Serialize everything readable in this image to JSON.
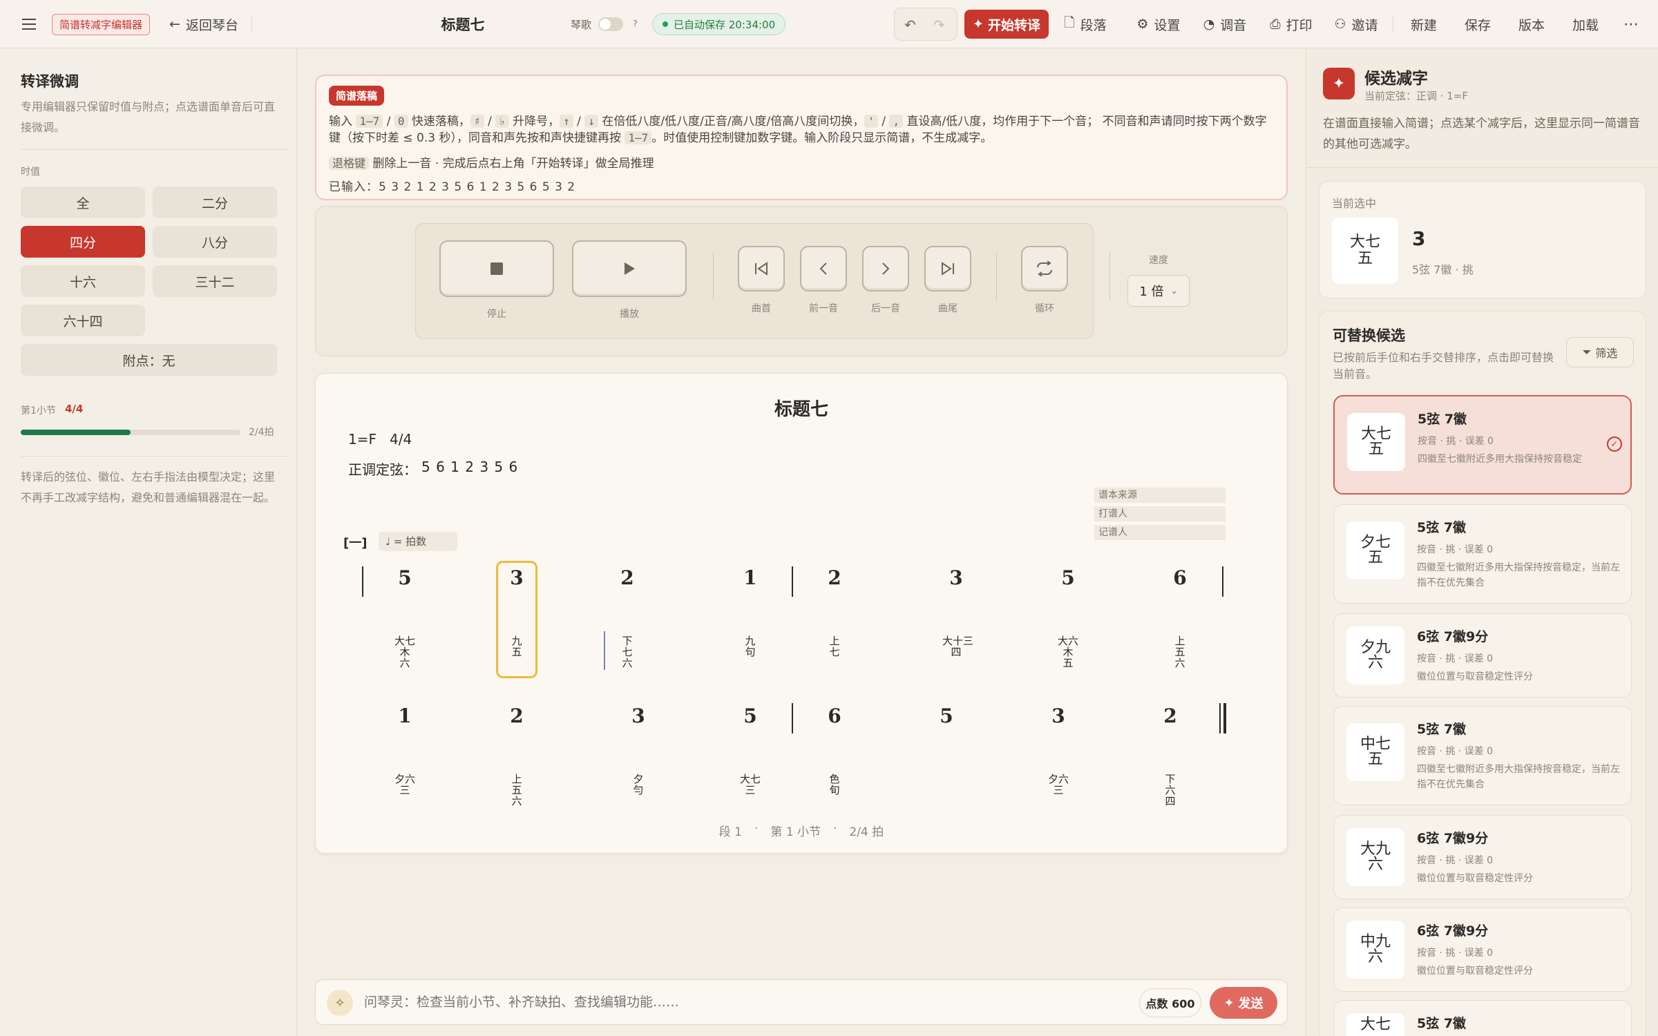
{
  "topbar": {
    "app_badge": "简谱转减字编辑器",
    "back_label": "返回琴台",
    "title": "标题七",
    "sing_label": "琴歌",
    "help": "?",
    "autosave": "已自动保存 20:34:00",
    "start_label": "开始转译",
    "menu": [
      "段落",
      "设置",
      "调音",
      "打印",
      "邀请"
    ],
    "actions": [
      "新建",
      "保存",
      "版本",
      "加载"
    ]
  },
  "left": {
    "title": "转译微调",
    "desc": "专用编辑器只保留时值与附点；点选谱面单音后可直接微调。",
    "duration_label": "时值",
    "durations": [
      "全",
      "二分",
      "四分",
      "八分",
      "十六",
      "三十二",
      "六十四"
    ],
    "dot_label": "附点：无",
    "measure_label": "第1小节",
    "measure_value": "4/4",
    "progress_text": "2/4拍",
    "progress": 0.5,
    "note": "转译后的弦位、徽位、左右手指法由模型决定；这里不再手工改减字结构，避免和普通编辑器混在一起。"
  },
  "draft": {
    "tag": "简谱落稿",
    "line1_a": "输入",
    "k1": "1–7",
    "k2": "0",
    "line1_b": "快速落稿，",
    "k3": "♯",
    "k4": "♭",
    "line1_c": "升降号，",
    "k5": "↑",
    "k6": "↓",
    "line1_d": "在倍低八度/低八度/正音/高八度/倍高八度间切换，",
    "k7": "'",
    "k8": ",",
    "line1_e": "直设高/低八度，均作用于下一个音； 不同音和声请同时按下两个数字键（按下时差 ≤ 0.3 秒），同音和声先按和声快捷键再按",
    "k9": "1–7",
    "line1_f": "。时值使用控制键加数字键。输入阶段只显示简谱，不生成减字。",
    "k10": "退格键",
    "line2": "删除上一音 · 完成后点右上角「开始转译」做全局推理",
    "entered": "已输入：5 3 2 1 2 3 5 6 1 2 3 5 6 5 3 2"
  },
  "player": {
    "labels": [
      "停止",
      "播放",
      "曲首",
      "前一音",
      "后一音",
      "曲尾",
      "循环"
    ],
    "speed_label": "速度",
    "speed_value": "1 倍"
  },
  "score": {
    "title": "标题七",
    "key": "1=F",
    "meter": "4/4",
    "tuning_label": "正调定弦：",
    "tuning": "5 6 1 2 3 5 6",
    "source_fields": [
      "谱本来源",
      "打谱人",
      "记谱人"
    ],
    "section": "[一]",
    "tempo": "♩ = 拍数",
    "row1_nums": [
      "5",
      "3",
      "2",
      "1",
      "2",
      "3",
      "5",
      "6"
    ],
    "row1_jz": [
      "大七\n木\n六",
      "九\n五",
      "下\n七\n六",
      "九\n句",
      "上\n七",
      "大十三\n四",
      "大六\n木\n五",
      "上\n五\n六"
    ],
    "row2_nums": [
      "1",
      "2",
      "3",
      "5",
      "6",
      "5",
      "3",
      "2"
    ],
    "row2_jz": [
      "夕六\n三",
      "上\n五\n六",
      "夕\n勻",
      "大七\n三",
      "色\n旬",
      "",
      "夕六\n三",
      "下\n六\n四"
    ],
    "status": [
      "段 1",
      "·",
      "第 1 小节",
      "·",
      "2/4 拍"
    ]
  },
  "chat": {
    "placeholder": "问琴灵：检查当前小节、补齐缺拍、查找编辑功能……",
    "points": "点数 600",
    "send": "发送"
  },
  "right": {
    "title": "候选减字",
    "subtitle": "当前定弦：正调 · 1=F",
    "desc": "在谱面直接输入简谱；点选某个减字后，这里显示同一简谱音的其他可选减字。",
    "current_label": "当前选中",
    "current_glyph": "大七\n五",
    "current_num": "3",
    "current_detail": "5弦 7徽 · 挑",
    "alt_title": "可替换候选",
    "alt_desc": "已按前后手位和右手交替排序，点击即可替换当前音。",
    "filter_label": "筛选",
    "candidates": [
      {
        "glyph": "大七\n五",
        "name": "5弦 7徽",
        "sub": "按音 · 挑 · 误差 0",
        "note": "四徽至七徽附近多用大指保持按音稳定"
      },
      {
        "glyph": "夕七\n五",
        "name": "5弦 7徽",
        "sub": "按音 · 挑 · 误差 0",
        "note": "四徽至七徽附近多用大指保持按音稳定，当前左指不在优先集合"
      },
      {
        "glyph": "夕九\n六",
        "name": "6弦 7徽9分",
        "sub": "按音 · 挑 · 误差 0",
        "note": "徽位位置与取音稳定性评分"
      },
      {
        "glyph": "中七\n五",
        "name": "5弦 7徽",
        "sub": "按音 · 挑 · 误差 0",
        "note": "四徽至七徽附近多用大指保持按音稳定，当前左指不在优先集合"
      },
      {
        "glyph": "大九\n六",
        "name": "6弦 7徽9分",
        "sub": "按音 · 挑 · 误差 0",
        "note": "徽位位置与取音稳定性评分"
      },
      {
        "glyph": "中九\n六",
        "name": "6弦 7徽9分",
        "sub": "按音 · 挑 · 误差 0",
        "note": "徽位位置与取音稳定性评分"
      },
      {
        "glyph": "大七",
        "name": "5弦 7徽",
        "sub": "",
        "note": ""
      }
    ]
  }
}
